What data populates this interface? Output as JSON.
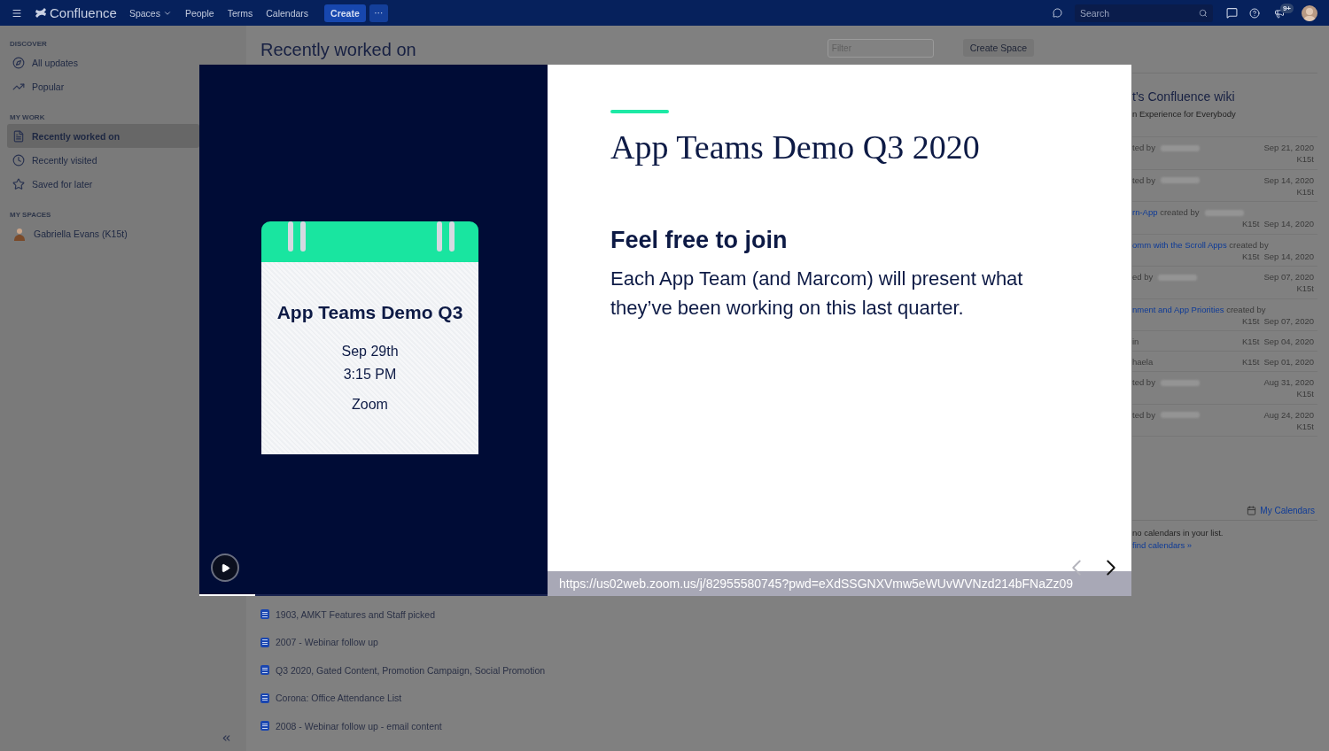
{
  "topbar": {
    "product": "Confluence",
    "nav": [
      {
        "label": "Spaces",
        "dropdown": true
      },
      {
        "label": "People",
        "dropdown": false
      },
      {
        "label": "Terms",
        "dropdown": false
      },
      {
        "label": "Calendars",
        "dropdown": false
      }
    ],
    "create": "Create",
    "more": "···",
    "search": {
      "placeholder": "Search"
    },
    "notifications_badge": "9+"
  },
  "sidebar": {
    "sections": [
      {
        "heading": "DISCOVER",
        "items": [
          {
            "label": "All updates",
            "selected": false
          },
          {
            "label": "Popular",
            "selected": false
          }
        ]
      },
      {
        "heading": "MY WORK",
        "items": [
          {
            "label": "Recently worked on",
            "selected": true
          },
          {
            "label": "Recently visited",
            "selected": false
          },
          {
            "label": "Saved for later",
            "selected": false
          }
        ]
      },
      {
        "heading": "MY SPACES",
        "items": [
          {
            "label": "Gabriella Evans (K15t)",
            "selected": false
          }
        ]
      }
    ]
  },
  "main": {
    "title": "Recently worked on",
    "filter": {
      "placeholder": "Filter"
    },
    "create_space": "Create Space",
    "pages": [
      "1903, AMKT Features and Staff picked",
      "2007 - Webinar follow up",
      "Q3 2020, Gated Content, Promotion Campaign, Social Promotion",
      "Corona: Office Attendance List",
      "2008 - Webinar follow up - email content"
    ]
  },
  "right_panel": {
    "title": "t's Confluence wiki",
    "subtitle": "n Experience for Everybody",
    "activity": [
      {
        "kind": "stacked",
        "text": "ted by",
        "blurred": true,
        "date": "Sep 21, 2020",
        "space": "K15t"
      },
      {
        "kind": "stacked",
        "text": "ted by",
        "blurred": true,
        "date": "Sep 14, 2020",
        "space": "K15t"
      },
      {
        "kind": "wrapped",
        "link": "rn-App",
        "text": "created by",
        "blurred": true,
        "date": "Sep 14, 2020",
        "space": "K15t"
      },
      {
        "kind": "wrapped",
        "link": "omm with the Scroll Apps",
        "text": "created by",
        "blurred": false,
        "date": "Sep 14, 2020",
        "space": "K15t"
      },
      {
        "kind": "stacked",
        "text": "ed by",
        "blurred": true,
        "date": "Sep 07, 2020",
        "space": "K15t"
      },
      {
        "kind": "wrapped",
        "link": "nment and App Priorities",
        "text": "created by",
        "blurred": false,
        "date": "Sep 07, 2020",
        "space": "K15t"
      },
      {
        "kind": "single",
        "text": "in",
        "blurred": false,
        "date": "Sep 04, 2020",
        "space": "K15t"
      },
      {
        "kind": "single",
        "text": "haela",
        "blurred": false,
        "date": "Sep 01, 2020",
        "space": "K15t"
      },
      {
        "kind": "stacked",
        "text": "ted by",
        "blurred": true,
        "date": "Aug 31, 2020",
        "space": "K15t"
      },
      {
        "kind": "stacked",
        "text": "ted by",
        "blurred": true,
        "date": "Aug 24, 2020",
        "space": "K15t"
      }
    ],
    "calendars": {
      "title": "My Calendars",
      "message": "no calendars in your list.",
      "link": "find calendars »"
    }
  },
  "modal": {
    "video": {
      "card_title": "App Teams Demo Q3",
      "date": "Sep 29th",
      "time": "3:15 PM",
      "place": "Zoom",
      "level": 0.16
    },
    "slide": {
      "title": "App Teams Demo Q3 2020",
      "heading": "Feel free to join",
      "body": "Each App Team (and Marcom) will present what they’ve been working on this last quarter.",
      "url": "https://us02web.zoom.us/j/82955580745?pwd=eXdSSGNXVmw5eWUvWVNzd214bFNaZz09"
    },
    "prev_disabled": true,
    "next_disabled": false
  }
}
